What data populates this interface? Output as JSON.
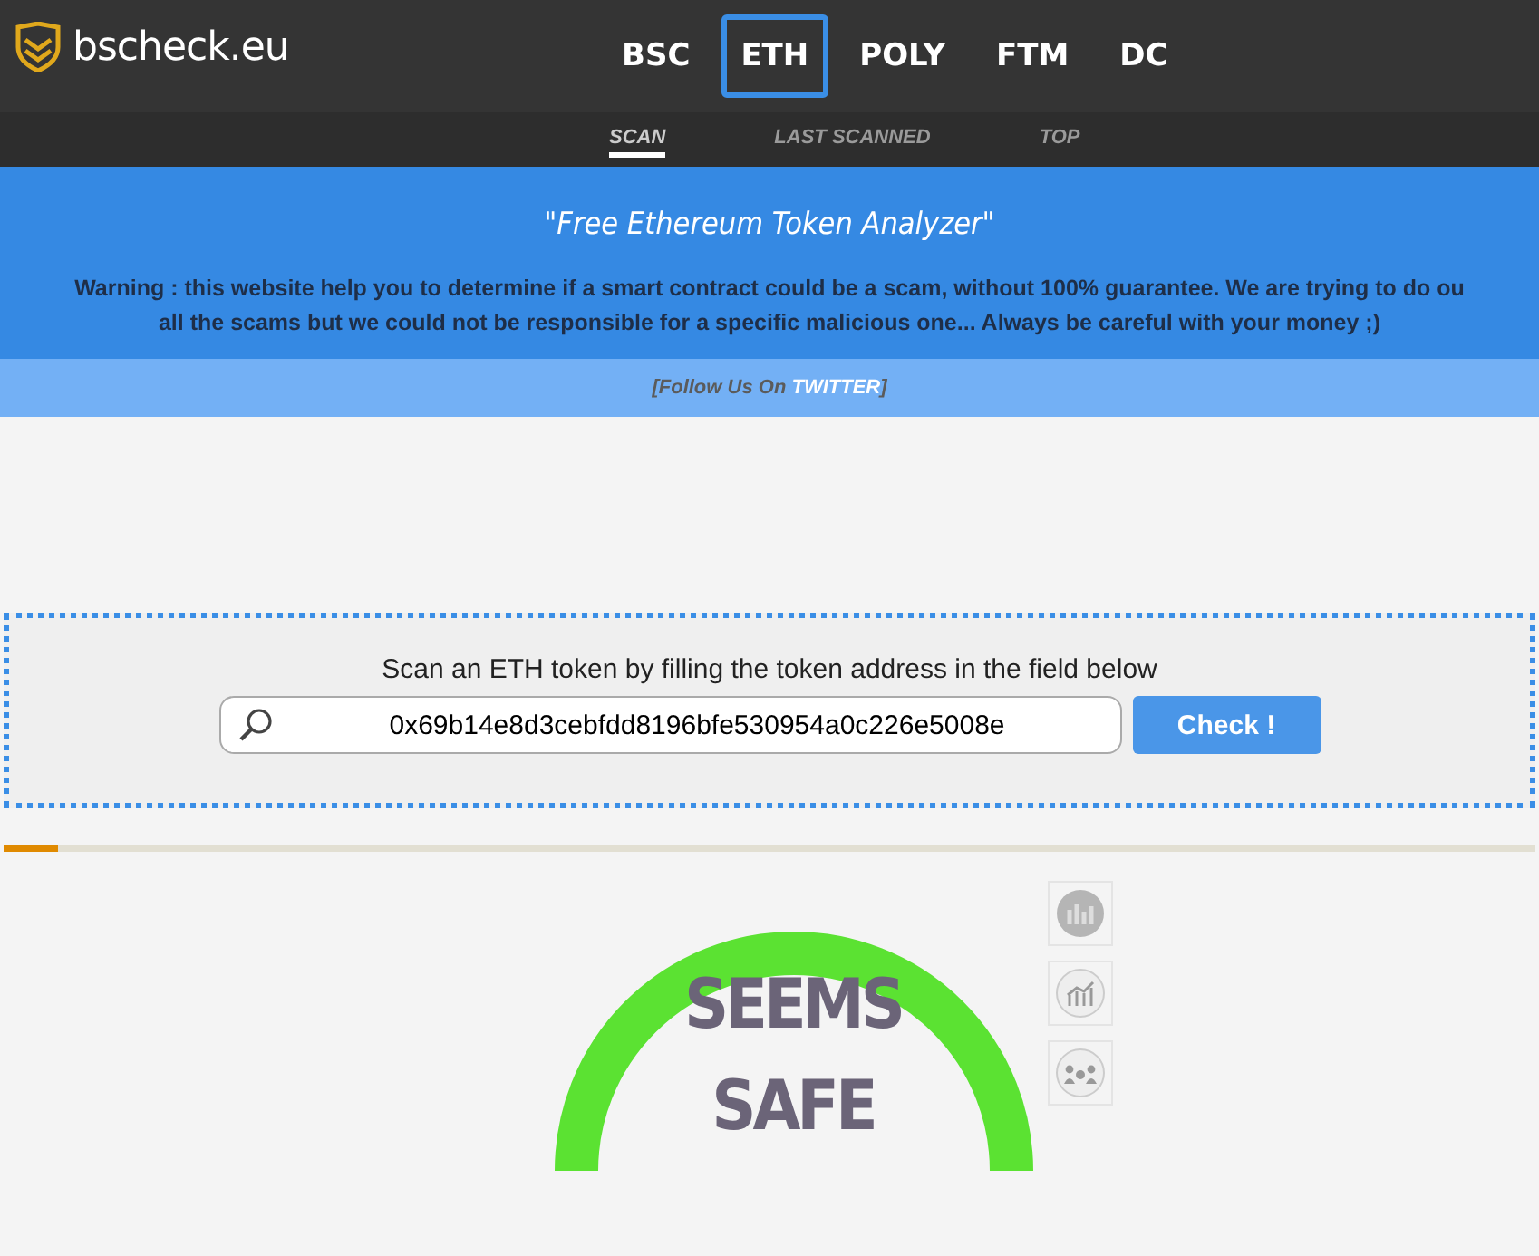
{
  "header": {
    "logo_text": "bscheck.eu",
    "chains": [
      {
        "label": "BSC",
        "selected": false
      },
      {
        "label": "ETH",
        "selected": true
      },
      {
        "label": "POLY",
        "selected": false
      },
      {
        "label": "FTM",
        "selected": false
      },
      {
        "label": "DC",
        "selected": false
      }
    ]
  },
  "subnav": [
    {
      "label": "SCAN",
      "selected": true
    },
    {
      "label": "LAST SCANNED",
      "selected": false
    },
    {
      "label": "TOP",
      "selected": false
    }
  ],
  "banner": {
    "title": "\"Free Ethereum Token Analyzer\"",
    "warning_lines": [
      "Warning : this website help you to determine if a smart contract could be a scam, without 100% guarantee. We are trying to do ou",
      "all the scams but we could not be responsible for a specific malicious one... Always be careful with your money ;)"
    ]
  },
  "follow": {
    "prefix": "[Follow Us On ",
    "link": "TWITTER",
    "suffix": "]"
  },
  "scan": {
    "instruction": "Scan an ETH token by filling the token address in the field below",
    "address": "0x69b14e8d3cebfdd8196bfe530954a0c226e5008e",
    "button": "Check !"
  },
  "progress": {
    "level": 0.035
  },
  "result": {
    "verdict": "SEEMS SAFE"
  }
}
